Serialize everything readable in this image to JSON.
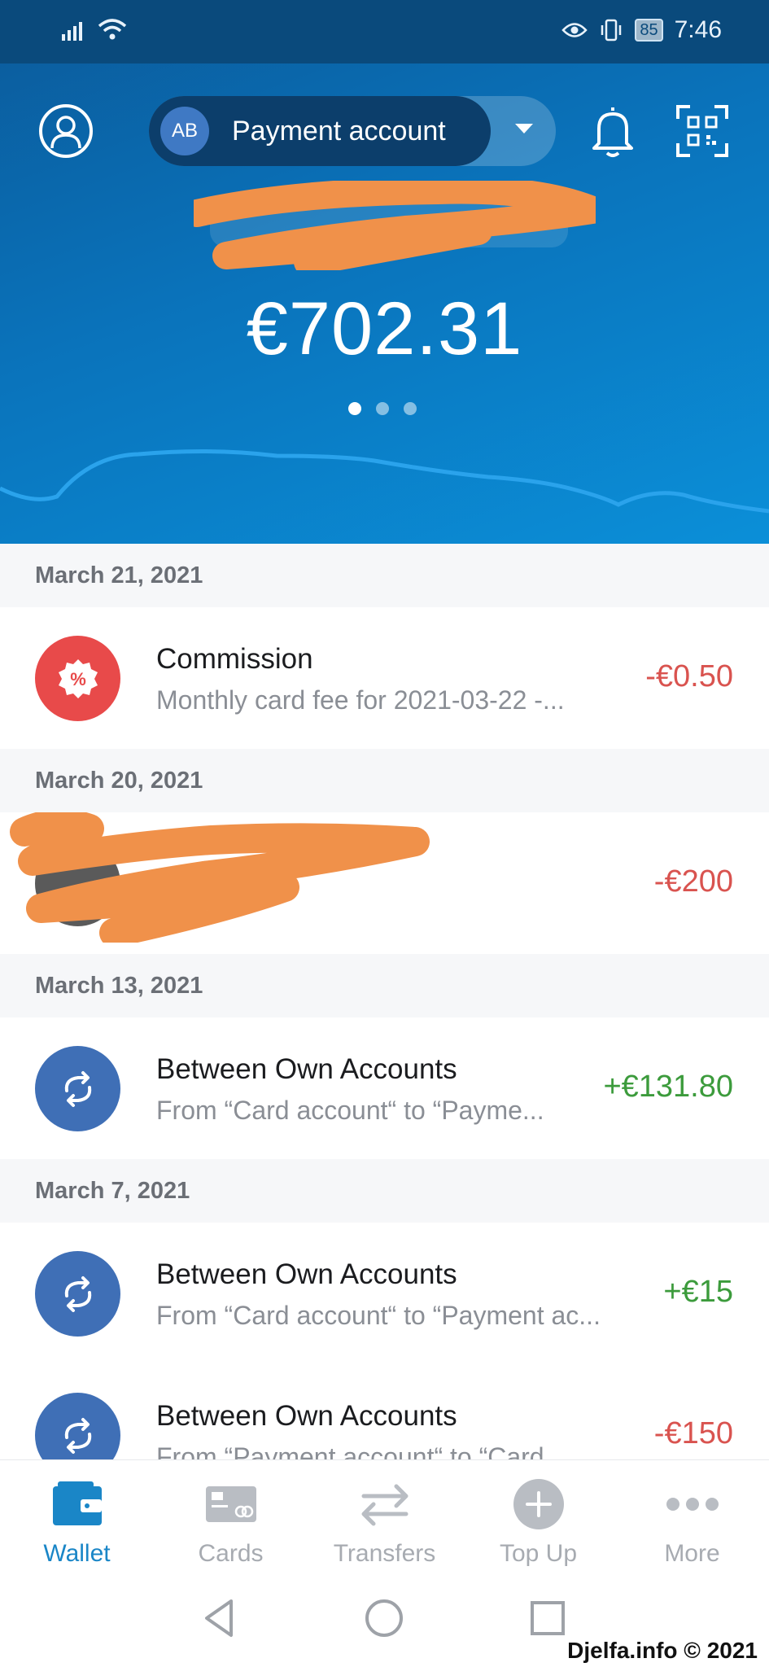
{
  "status_bar": {
    "time": "7:46",
    "battery": "85"
  },
  "header": {
    "account_initials": "AB",
    "account_name": "Payment account",
    "balance": "€702.31",
    "carousel_pages": 3,
    "carousel_active": 0
  },
  "transactions": [
    {
      "date": "March 21, 2021",
      "title": "Commission",
      "subtitle": "Monthly card fee for 2021-03-22 -...",
      "amount": "-€0.50",
      "type": "negative",
      "icon": "percent-icon",
      "icon_color": "#e84a4a"
    },
    {
      "date": "March 20, 2021",
      "title": "",
      "subtitle": "",
      "amount": "-€200",
      "type": "negative",
      "icon": "avatar-icon",
      "icon_color": "#5a5a5a"
    },
    {
      "date": "March 13, 2021",
      "title": "Between Own Accounts",
      "subtitle": "From “Card account“ to “Payme...",
      "amount": "+€131.80",
      "type": "positive",
      "icon": "exchange-icon",
      "icon_color": "#3f6fb6"
    },
    {
      "date": "March 7, 2021",
      "title": "Between Own Accounts",
      "subtitle": "From “Card account“ to “Payment ac...",
      "amount": "+€15",
      "type": "positive",
      "icon": "exchange-icon",
      "icon_color": "#3f6fb6"
    },
    {
      "date": "",
      "title": "Between Own Accounts",
      "subtitle": "From “Payment account“ to “Card...",
      "amount": "-€150",
      "type": "negative",
      "icon": "exchange-icon",
      "icon_color": "#3f6fb6"
    }
  ],
  "bottom_nav": [
    {
      "label": "Wallet",
      "icon": "wallet-icon",
      "active": true
    },
    {
      "label": "Cards",
      "icon": "card-icon",
      "active": false
    },
    {
      "label": "Transfers",
      "icon": "transfer-icon",
      "active": false
    },
    {
      "label": "Top Up",
      "icon": "plus-circle-icon",
      "active": false
    },
    {
      "label": "More",
      "icon": "more-icon",
      "active": false
    }
  ],
  "watermark": "Djelfa.info © 2021",
  "colors": {
    "accent": "#1a86c7",
    "negative": "#d9534f",
    "positive": "#3c9b3c"
  }
}
